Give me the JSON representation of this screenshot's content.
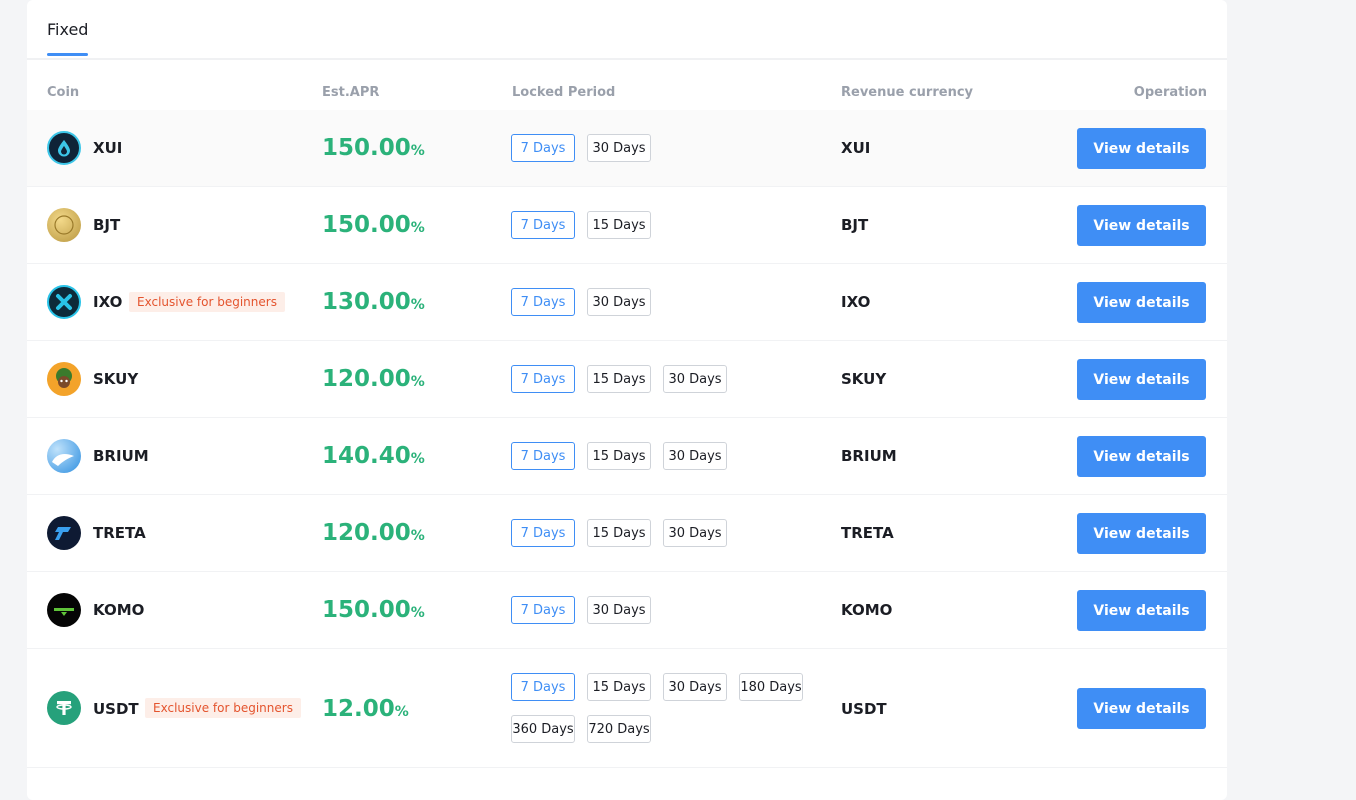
{
  "tabs": {
    "fixed": "Fixed"
  },
  "columns": {
    "coin": "Coin",
    "apr": "Est.APR",
    "period": "Locked Period",
    "revenue": "Revenue currency",
    "operation": "Operation"
  },
  "rows": [
    {
      "coin": "XUI",
      "badge": "",
      "apr": "150.00",
      "pct": "%",
      "periods": [
        "7 Days",
        "30 Days"
      ],
      "revenue": "XUI",
      "action": "View details",
      "icon": "xui-coin-icon"
    },
    {
      "coin": "BJT",
      "badge": "",
      "apr": "150.00",
      "pct": "%",
      "periods": [
        "7 Days",
        "15 Days"
      ],
      "revenue": "BJT",
      "action": "View details",
      "icon": "bjt-coin-icon"
    },
    {
      "coin": "IXO",
      "badge": "Exclusive for beginners",
      "apr": "130.00",
      "pct": "%",
      "periods": [
        "7 Days",
        "30 Days"
      ],
      "revenue": "IXO",
      "action": "View details",
      "icon": "ixo-coin-icon"
    },
    {
      "coin": "SKUY",
      "badge": "",
      "apr": "120.00",
      "pct": "%",
      "periods": [
        "7 Days",
        "15 Days",
        "30 Days"
      ],
      "revenue": "SKUY",
      "action": "View details",
      "icon": "skuy-coin-icon"
    },
    {
      "coin": "BRIUM",
      "badge": "",
      "apr": "140.40",
      "pct": "%",
      "periods": [
        "7 Days",
        "15 Days",
        "30 Days"
      ],
      "revenue": "BRIUM",
      "action": "View details",
      "icon": "brium-coin-icon"
    },
    {
      "coin": "TRETA",
      "badge": "",
      "apr": "120.00",
      "pct": "%",
      "periods": [
        "7 Days",
        "15 Days",
        "30 Days"
      ],
      "revenue": "TRETA",
      "action": "View details",
      "icon": "treta-coin-icon"
    },
    {
      "coin": "KOMO",
      "badge": "",
      "apr": "150.00",
      "pct": "%",
      "periods": [
        "7 Days",
        "30 Days"
      ],
      "revenue": "KOMO",
      "action": "View details",
      "icon": "komo-coin-icon"
    },
    {
      "coin": "USDT",
      "badge": "Exclusive for beginners",
      "apr": "12.00",
      "pct": "%",
      "periods": [
        "7 Days",
        "15 Days",
        "30 Days",
        "180 Days",
        "360 Days",
        "720 Days"
      ],
      "revenue": "USDT",
      "action": "View details",
      "icon": "usdt-coin-icon"
    }
  ],
  "colors": {
    "accent": "#3f8ef5",
    "apr": "#2bb27a",
    "badge_text": "#e4542e",
    "badge_bg": "#fdeee8"
  }
}
